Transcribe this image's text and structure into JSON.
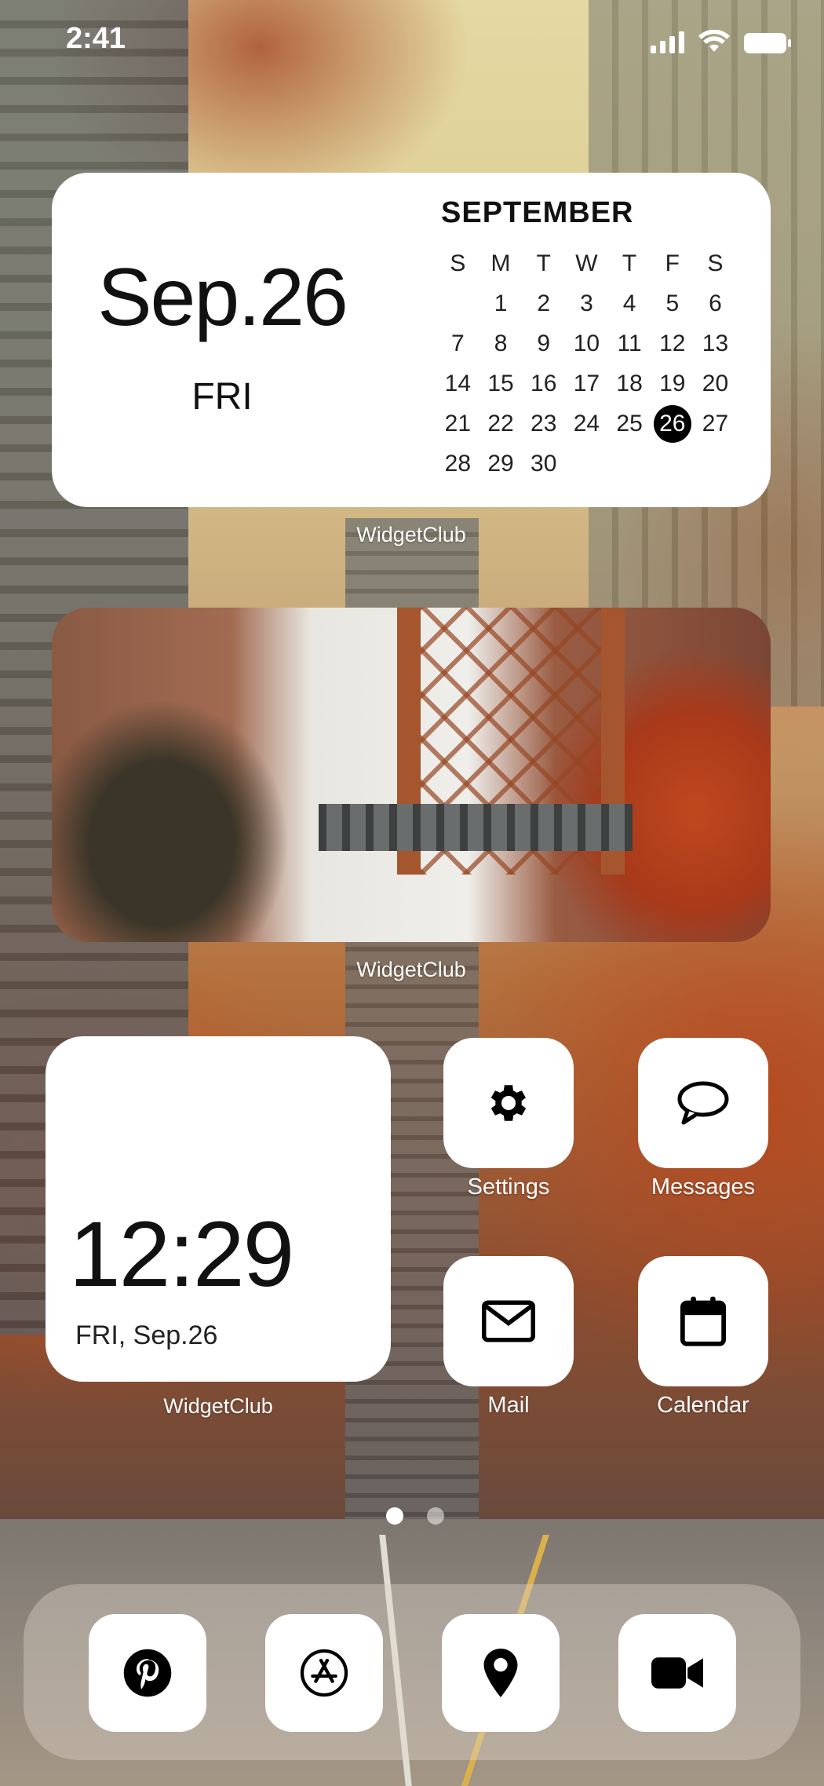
{
  "status_bar": {
    "time": "2:41",
    "signal_icon": "signal-icon",
    "wifi_icon": "wifi-icon",
    "battery_icon": "battery-icon"
  },
  "calendar_widget": {
    "date": "Sep.26",
    "weekday": "FRI",
    "month": "SEPTEMBER",
    "day_headers": [
      "S",
      "M",
      "T",
      "W",
      "T",
      "F",
      "S"
    ],
    "weeks": [
      [
        "",
        "1",
        "2",
        "3",
        "4",
        "5",
        "6"
      ],
      [
        "7",
        "8",
        "9",
        "10",
        "11",
        "12",
        "13"
      ],
      [
        "14",
        "15",
        "16",
        "17",
        "18",
        "19",
        "20"
      ],
      [
        "21",
        "22",
        "23",
        "24",
        "25",
        "26",
        "27"
      ],
      [
        "28",
        "29",
        "30",
        "",
        "",
        "",
        ""
      ]
    ],
    "today": "26",
    "label": "WidgetClub"
  },
  "photo_widget": {
    "label": "WidgetClub"
  },
  "clock_widget": {
    "time": "12:29",
    "date": "FRI, Sep.26",
    "label": "WidgetClub"
  },
  "apps": [
    {
      "name": "Settings",
      "icon": "gear-icon"
    },
    {
      "name": "Messages",
      "icon": "speech-bubble-icon"
    },
    {
      "name": "Mail",
      "icon": "envelope-icon"
    },
    {
      "name": "Calendar",
      "icon": "calendar-icon"
    }
  ],
  "page_indicator": {
    "pages": 2,
    "current": 1
  },
  "dock": [
    {
      "icon": "pinterest-icon"
    },
    {
      "icon": "app-store-icon"
    },
    {
      "icon": "map-pin-icon"
    },
    {
      "icon": "video-camera-icon"
    }
  ],
  "colors": {
    "widget_bg": "#ffffff",
    "text": "#111111",
    "today_circle": "#000000"
  }
}
